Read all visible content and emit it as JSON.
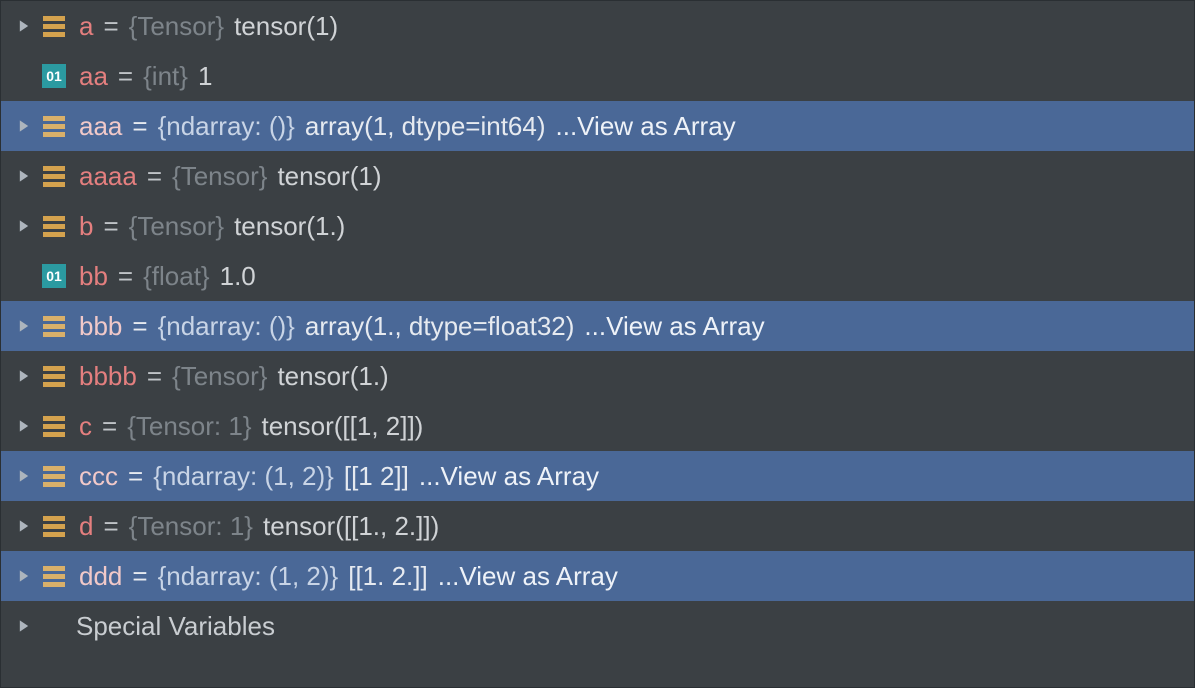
{
  "icons": {
    "primitive_label": "01"
  },
  "vars": [
    {
      "name": "a",
      "type": "{Tensor}",
      "value": "tensor(1)",
      "expandable": true,
      "icon": "struct",
      "selected": false,
      "view": null
    },
    {
      "name": "aa",
      "type": "{int}",
      "value": "1",
      "expandable": false,
      "icon": "prim",
      "selected": false,
      "view": null
    },
    {
      "name": "aaa",
      "type": "{ndarray: ()}",
      "value": "array(1, dtype=int64)",
      "expandable": true,
      "icon": "struct",
      "selected": true,
      "view": "...View as Array"
    },
    {
      "name": "aaaa",
      "type": "{Tensor}",
      "value": "tensor(1)",
      "expandable": true,
      "icon": "struct",
      "selected": false,
      "view": null
    },
    {
      "name": "b",
      "type": "{Tensor}",
      "value": "tensor(1.)",
      "expandable": true,
      "icon": "struct",
      "selected": false,
      "view": null
    },
    {
      "name": "bb",
      "type": "{float}",
      "value": "1.0",
      "expandable": false,
      "icon": "prim",
      "selected": false,
      "view": null
    },
    {
      "name": "bbb",
      "type": "{ndarray: ()}",
      "value": "array(1., dtype=float32)",
      "expandable": true,
      "icon": "struct",
      "selected": true,
      "view": "...View as Array"
    },
    {
      "name": "bbbb",
      "type": "{Tensor}",
      "value": "tensor(1.)",
      "expandable": true,
      "icon": "struct",
      "selected": false,
      "view": null
    },
    {
      "name": "c",
      "type": "{Tensor: 1}",
      "value": "tensor([[1, 2]])",
      "expandable": true,
      "icon": "struct",
      "selected": false,
      "view": null
    },
    {
      "name": "ccc",
      "type": "{ndarray: (1, 2)}",
      "value": "[[1 2]]",
      "expandable": true,
      "icon": "struct",
      "selected": true,
      "view": "...View as Array"
    },
    {
      "name": "d",
      "type": "{Tensor: 1}",
      "value": "tensor([[1., 2.]])",
      "expandable": true,
      "icon": "struct",
      "selected": false,
      "view": null
    },
    {
      "name": "ddd",
      "type": "{ndarray: (1, 2)}",
      "value": "[[1. 2.]]",
      "expandable": true,
      "icon": "struct",
      "selected": true,
      "view": "...View as Array"
    }
  ],
  "special": {
    "label": "Special Variables"
  }
}
